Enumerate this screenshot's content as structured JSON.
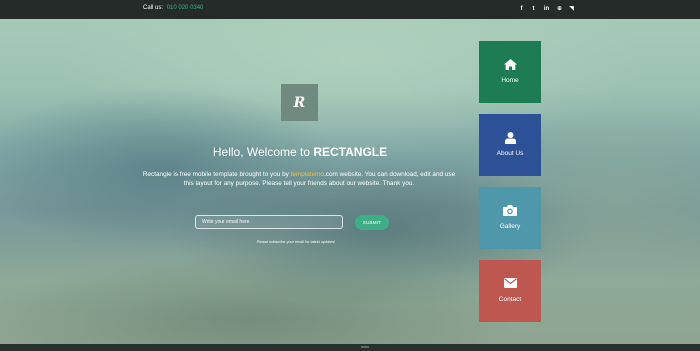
{
  "topbar": {
    "call_label": "Call us:",
    "phone": "010 020 0340",
    "social_icons": [
      "facebook-icon",
      "twitter-icon",
      "linkedin-icon",
      "dribbble-icon",
      "rss-icon"
    ],
    "social_glyphs": [
      "f",
      "t",
      "in",
      "⊕",
      "◥"
    ]
  },
  "logo": {
    "letter": "R"
  },
  "hero": {
    "welcome_prefix": "Hello, Welcome to ",
    "brand": "RECTANGLE",
    "desc_before": "Rectangle is free mobile template brought to you by ",
    "desc_link": "templatemo",
    "desc_after": ".com website. You can download, edit and use this layout for any purpose. Please tell your friends about our website. Thank you."
  },
  "subscribe": {
    "placeholder": "Write your email here",
    "submit_label": "SUBMIT",
    "note": "Please subscribe your email for latest updates!"
  },
  "tiles": [
    {
      "label": "Home",
      "icon": "home-icon",
      "color": "#1e7c55"
    },
    {
      "label": "About Us",
      "icon": "user-icon",
      "color": "#2d5196"
    },
    {
      "label": "Gallery",
      "icon": "camera-icon",
      "color": "#4f97aa"
    },
    {
      "label": "Contact",
      "icon": "envelope-icon",
      "color": "#bd5750"
    }
  ],
  "colors": {
    "accent": "#3fae87",
    "link": "#e8c24a",
    "topbar": "#252b29"
  }
}
